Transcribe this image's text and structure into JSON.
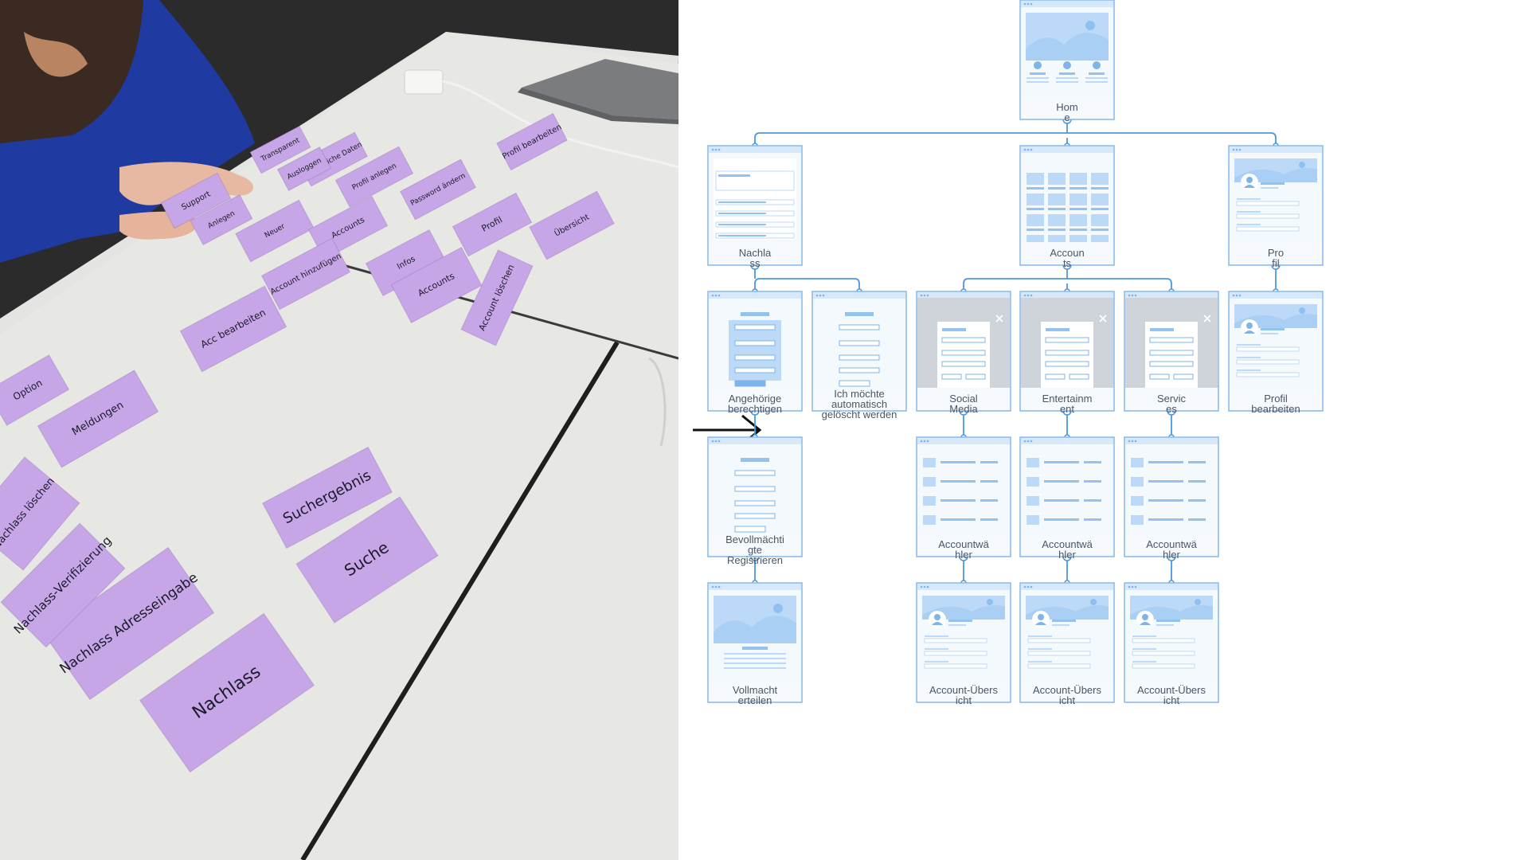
{
  "photo": {
    "notes": [
      {
        "text": "Profil bearbeiten"
      },
      {
        "text": "Transparent"
      },
      {
        "text": "Persönliche Daten"
      },
      {
        "text": "Profil anlegen"
      },
      {
        "text": "Ausloggen"
      },
      {
        "text": "Password ändern"
      },
      {
        "text": "Support"
      },
      {
        "text": "Profil"
      },
      {
        "text": "Übersicht"
      },
      {
        "text": "Account löschen"
      },
      {
        "text": "Neuer"
      },
      {
        "text": "Anlegen"
      },
      {
        "text": "Accounts"
      },
      {
        "text": "Infos"
      },
      {
        "text": "Accounts"
      },
      {
        "text": "Account hinzufügen"
      },
      {
        "text": "Acc bearbeiten"
      },
      {
        "text": "Meldungen"
      },
      {
        "text": "Option"
      },
      {
        "text": "Suchergebnis"
      },
      {
        "text": "Suche"
      },
      {
        "text": "Nachlass"
      },
      {
        "text": "Nachlass Adresseingabe"
      },
      {
        "text": "Nachlass-Verifizierung"
      },
      {
        "text": "Nachlass löschen"
      }
    ]
  },
  "sitemap": {
    "nodes": [
      {
        "id": "home",
        "label_lines": [
          "Hom",
          "e"
        ],
        "thumb": "landing"
      },
      {
        "id": "nachlass",
        "label_lines": [
          "Nachla",
          "ss"
        ],
        "thumb": "list"
      },
      {
        "id": "accounts",
        "label_lines": [
          "Accoun",
          "ts"
        ],
        "thumb": "grid"
      },
      {
        "id": "profil",
        "label_lines": [
          "Pro",
          "fil"
        ],
        "thumb": "profile"
      },
      {
        "id": "angehoerige",
        "label_lines": [
          "Angehörige",
          "berechtigen"
        ],
        "thumb": "form-blue"
      },
      {
        "id": "loeschen",
        "label_lines": [
          "Ich möchte",
          "automatisch",
          "gelöscht werden"
        ],
        "thumb": "form-plain"
      },
      {
        "id": "social",
        "label_lines": [
          "Social",
          "Media"
        ],
        "thumb": "modal"
      },
      {
        "id": "entertainment",
        "label_lines": [
          "Entertainm",
          "ent"
        ],
        "thumb": "modal"
      },
      {
        "id": "services",
        "label_lines": [
          "Servic",
          "es"
        ],
        "thumb": "modal"
      },
      {
        "id": "profil-bearbeiten",
        "label_lines": [
          "Profil",
          "bearbeiten"
        ],
        "thumb": "profile"
      },
      {
        "id": "bevollmaechtigte",
        "label_lines": [
          "Bevollmächti",
          "gte",
          "Registrieren"
        ],
        "thumb": "form-plain"
      },
      {
        "id": "acw-social",
        "label_lines": [
          "Accountwä",
          "hler"
        ],
        "thumb": "rows"
      },
      {
        "id": "acw-entertainment",
        "label_lines": [
          "Accountwä",
          "hler"
        ],
        "thumb": "rows"
      },
      {
        "id": "acw-services",
        "label_lines": [
          "Accountwä",
          "hler"
        ],
        "thumb": "rows"
      },
      {
        "id": "vollmacht",
        "label_lines": [
          "Vollmacht",
          "erteilen"
        ],
        "thumb": "landing-text"
      },
      {
        "id": "uebersicht-social",
        "label_lines": [
          "Account-Übers",
          "icht"
        ],
        "thumb": "profile"
      },
      {
        "id": "uebersicht-entertainment",
        "label_lines": [
          "Account-Übers",
          "icht"
        ],
        "thumb": "profile"
      },
      {
        "id": "uebersicht-services",
        "label_lines": [
          "Account-Übers",
          "icht"
        ],
        "thumb": "profile"
      }
    ],
    "edges": [
      [
        "home",
        "nachlass"
      ],
      [
        "home",
        "accounts"
      ],
      [
        "home",
        "profil"
      ],
      [
        "nachlass",
        "angehoerige"
      ],
      [
        "nachlass",
        "loeschen"
      ],
      [
        "accounts",
        "social"
      ],
      [
        "accounts",
        "entertainment"
      ],
      [
        "accounts",
        "services"
      ],
      [
        "profil",
        "profil-bearbeiten"
      ],
      [
        "angehoerige",
        "bevollmaechtigte"
      ],
      [
        "social",
        "acw-social"
      ],
      [
        "entertainment",
        "acw-entertainment"
      ],
      [
        "services",
        "acw-services"
      ],
      [
        "bevollmaechtigte",
        "vollmacht"
      ],
      [
        "acw-social",
        "uebersicht-social"
      ],
      [
        "acw-entertainment",
        "uebersicht-entertainment"
      ],
      [
        "acw-services",
        "uebersicht-services"
      ]
    ],
    "colors": {
      "connector": "#4c97df",
      "card_border": "#7db4ea",
      "card_fill": "#eef6fe",
      "modal_overlay": "#cfd4da",
      "note": "#c6a6e6",
      "table": "#e6e6e3"
    }
  },
  "arrow": {
    "icon": "right-arrow-icon"
  }
}
